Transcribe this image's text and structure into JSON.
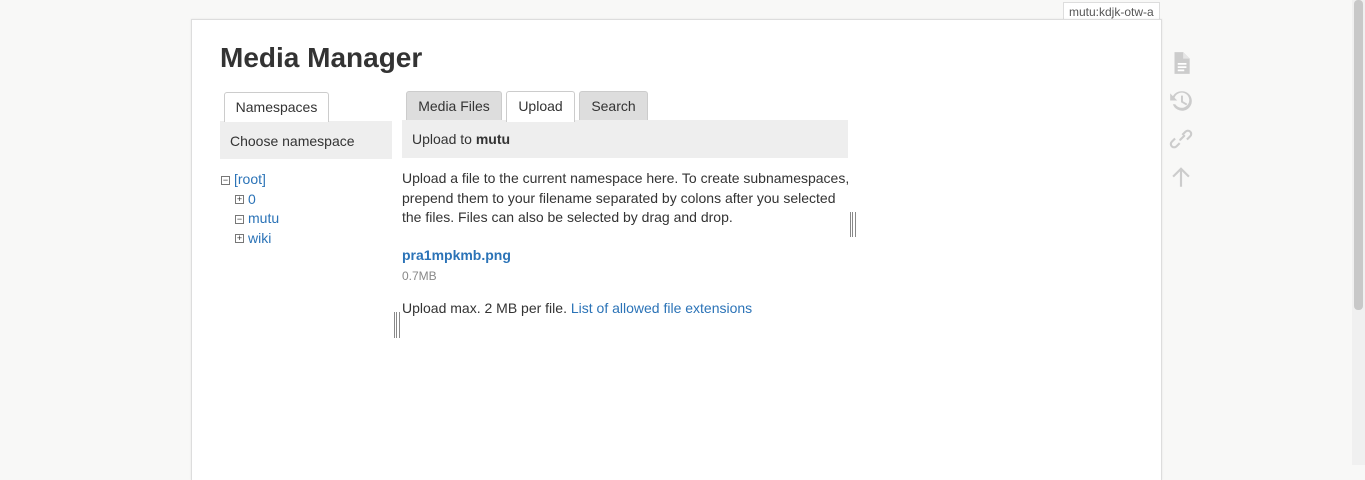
{
  "page_id": "mutu:kdjk-otw-a",
  "title": "Media Manager",
  "namespaces": {
    "tab_label": "Namespaces",
    "heading": "Choose namespace",
    "tree": {
      "root": "[root]",
      "children": [
        "0",
        "mutu",
        "wiki"
      ]
    }
  },
  "media": {
    "tabs": [
      "Media Files",
      "Upload",
      "Search"
    ],
    "active_tab": "Upload",
    "upload_heading_prefix": "Upload to",
    "upload_heading_ns": "mutu",
    "instructions": "Upload a file to the current namespace here. To create subnamespaces, prepend them to your filename separated by colons after you selected the files. Files can also be selected by drag and drop.",
    "file": {
      "name": "pra1mpkmb.png",
      "size": "0.7MB"
    },
    "max_text": "Upload max. 2 MB per file.",
    "extensions_link": "List of allowed file extensions"
  },
  "tools": [
    "page-icon",
    "history-icon",
    "link-icon",
    "back-to-top-icon"
  ],
  "colors": {
    "link": "#2b73b7",
    "icon": "#cccccc"
  }
}
